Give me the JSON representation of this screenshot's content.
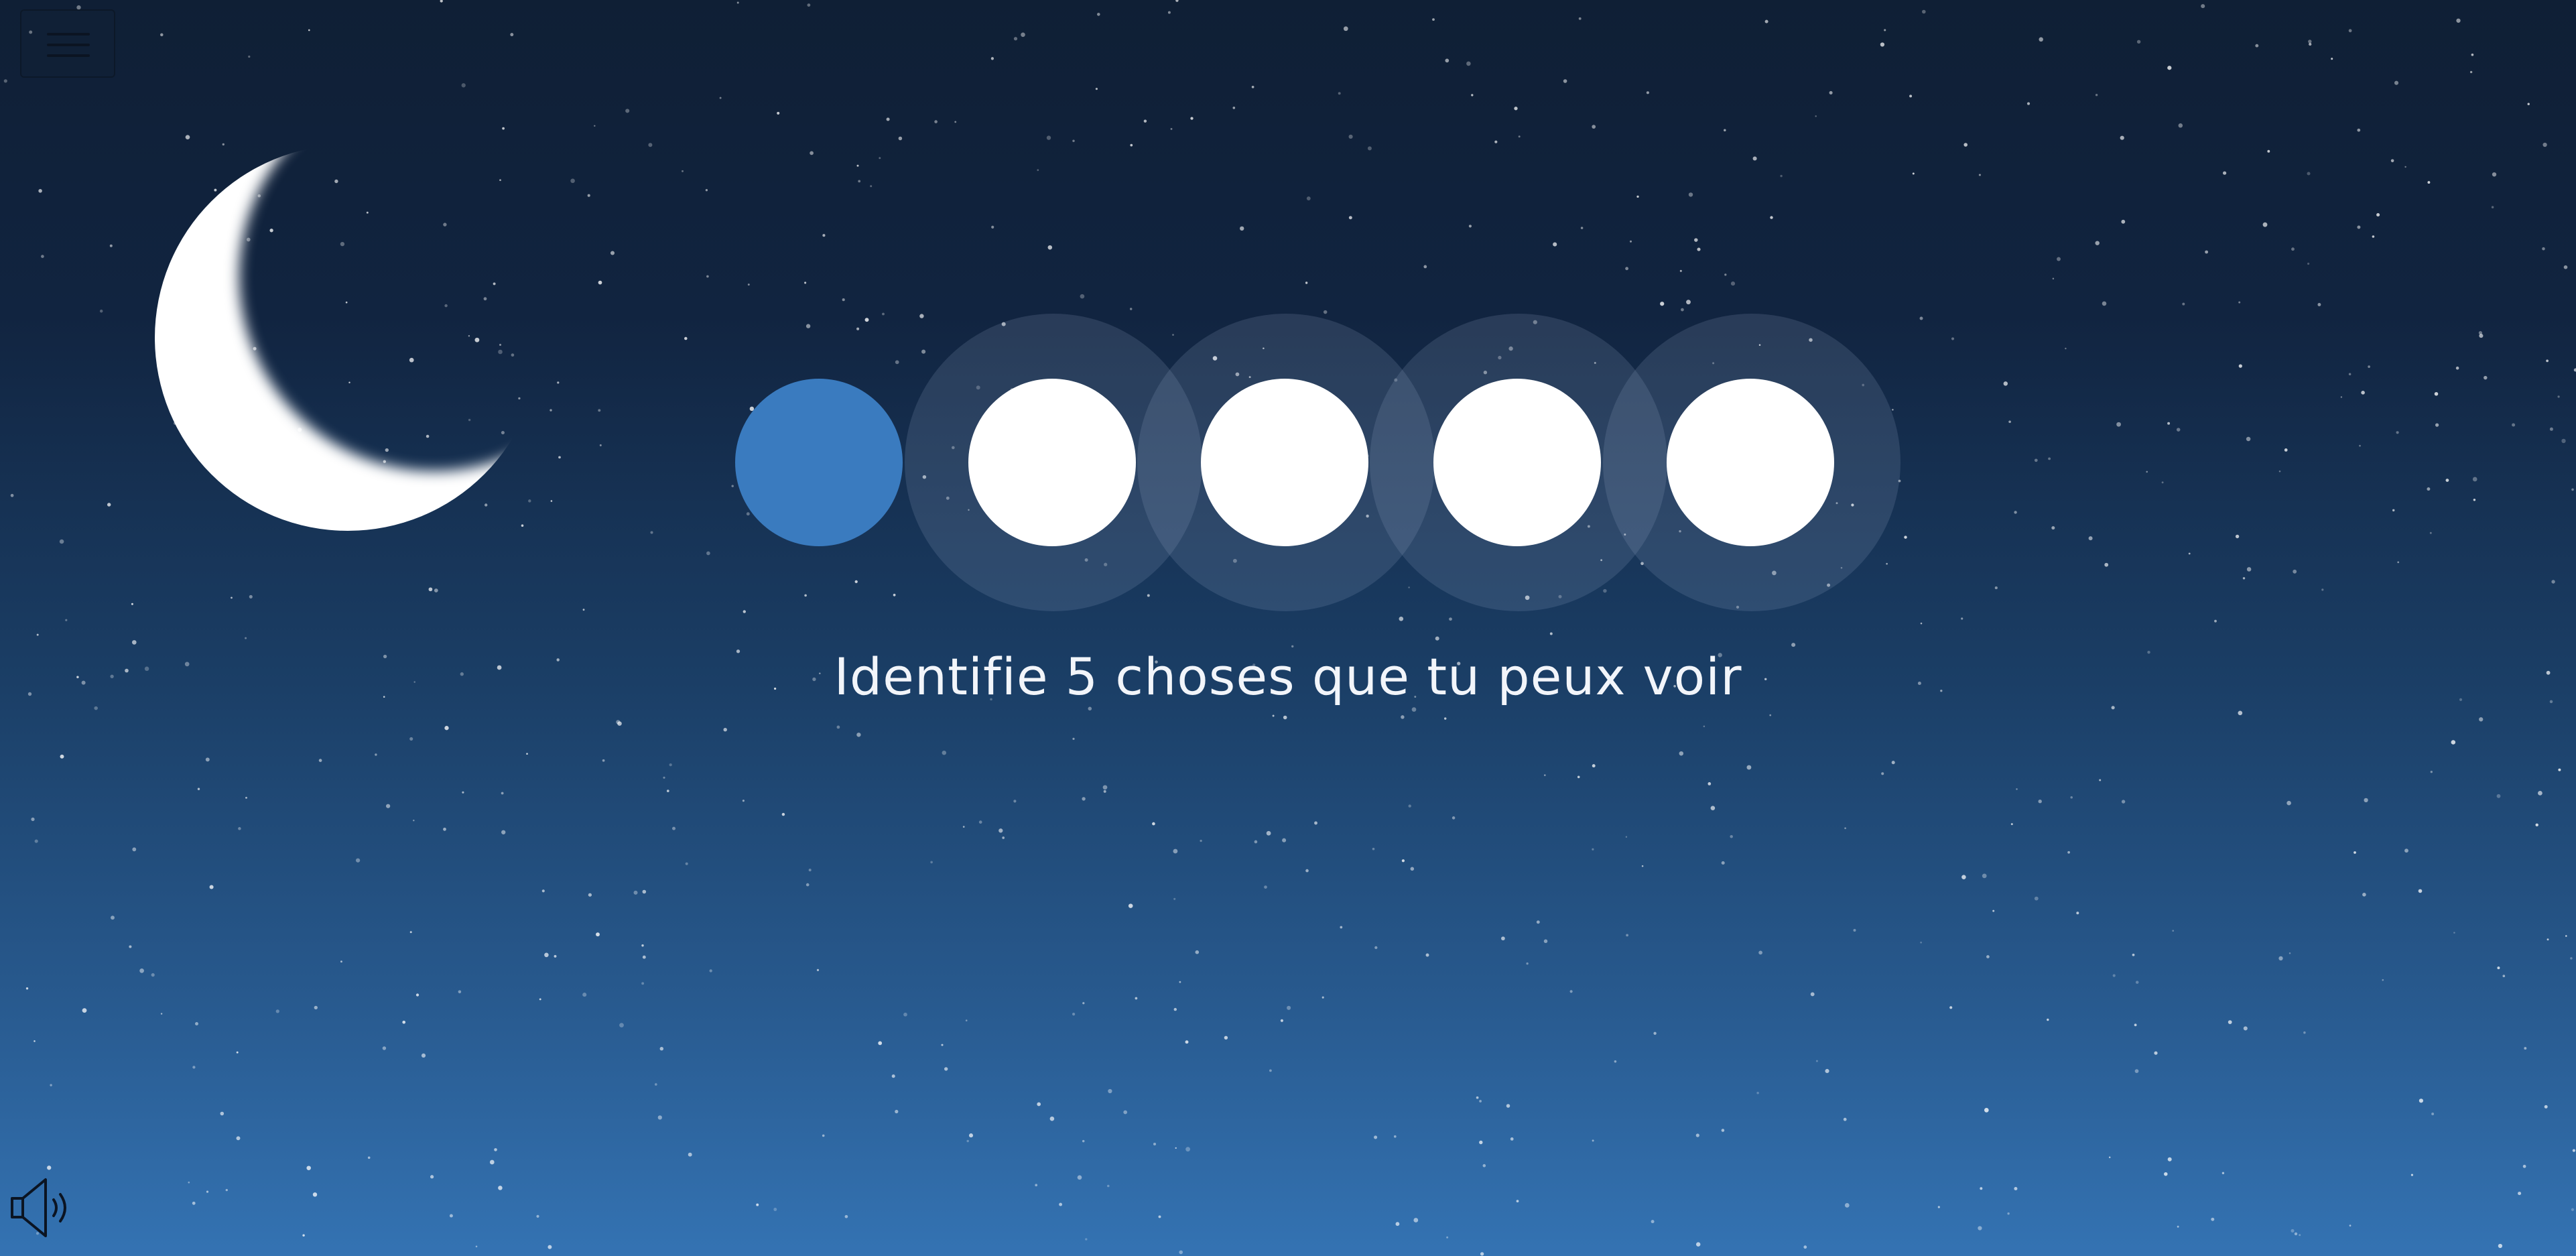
{
  "app": {
    "instruction": "Identifie 5 choses que tu peux voir"
  },
  "progress": {
    "total_steps": 5,
    "completed_steps": 1,
    "active_color": "#3a7bbf",
    "pending_color": "#ffffff"
  },
  "icons": {
    "menu": "hamburger-menu-icon",
    "sound": "speaker-icon",
    "decoration": "crescent-moon"
  },
  "colors": {
    "sky_top": "#0f1f35",
    "sky_bottom": "#3473b3",
    "text": "#f2f5fa"
  }
}
